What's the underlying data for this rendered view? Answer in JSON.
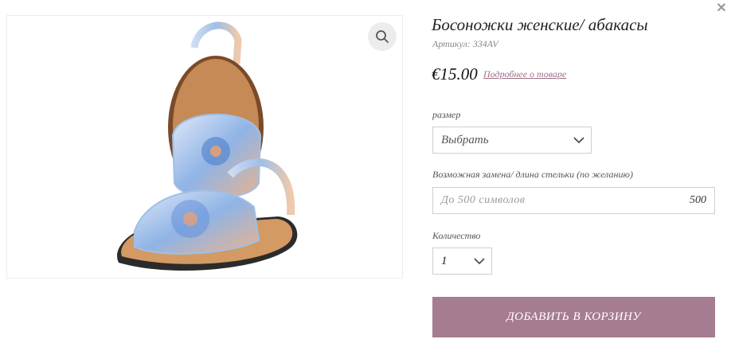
{
  "product": {
    "title": "Босоножки женские/ абакасы",
    "sku_label": "Артикул:",
    "sku_value": "334AV",
    "price": "€15.00",
    "details_link": "Подробнее о товаре"
  },
  "options": {
    "size_label": "размер",
    "size_value": "Выбрать",
    "insole_label": "Возможная замена/ длина стельки (по желанию)",
    "insole_placeholder": "До 500 символов",
    "insole_counter": "500",
    "quantity_label": "Количество",
    "quantity_value": "1"
  },
  "actions": {
    "add_to_cart": "ДОБАВИТЬ В КОРЗИНУ"
  },
  "icons": {
    "close": "close-icon",
    "zoom": "magnifier-icon",
    "dropdown": "chevron-down-icon"
  },
  "colors": {
    "accent": "#a67c90",
    "link": "#9e6f86",
    "border": "#cfcfcf"
  }
}
